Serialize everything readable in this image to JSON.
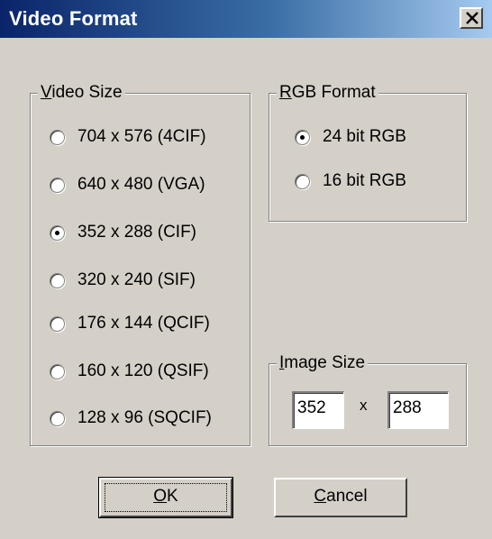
{
  "window": {
    "title": "Video Format"
  },
  "video_size": {
    "legend_accel": "V",
    "legend_rest": "ideo Size",
    "options": [
      {
        "label": "704 x 576 (4CIF)",
        "selected": false
      },
      {
        "label": "640 x 480 (VGA)",
        "selected": false
      },
      {
        "label": "352 x 288 (CIF)",
        "selected": true
      },
      {
        "label": "320 x 240 (SIF)",
        "selected": false
      },
      {
        "label": "176 x 144 (QCIF)",
        "selected": false
      },
      {
        "label": "160 x 120 (QSIF)",
        "selected": false
      },
      {
        "label": "128 x 96 (SQCIF)",
        "selected": false
      }
    ]
  },
  "rgb_format": {
    "legend_accel": "R",
    "legend_rest": "GB Format",
    "options": [
      {
        "label": "24 bit RGB",
        "selected": true
      },
      {
        "label": "16 bit RGB",
        "selected": false
      }
    ]
  },
  "image_size": {
    "legend_accel": "I",
    "legend_rest": "mage Size",
    "width_value": "352",
    "separator": "x",
    "height_value": "288"
  },
  "buttons": {
    "ok_accel": "O",
    "ok_rest": "K",
    "cancel_accel": "C",
    "cancel_rest": "ancel"
  },
  "colors": {
    "title_bar_start": "#0a246a",
    "title_bar_end": "#a6caf0",
    "face": "#d4d0c8"
  },
  "icons": {
    "close": "close-icon"
  }
}
